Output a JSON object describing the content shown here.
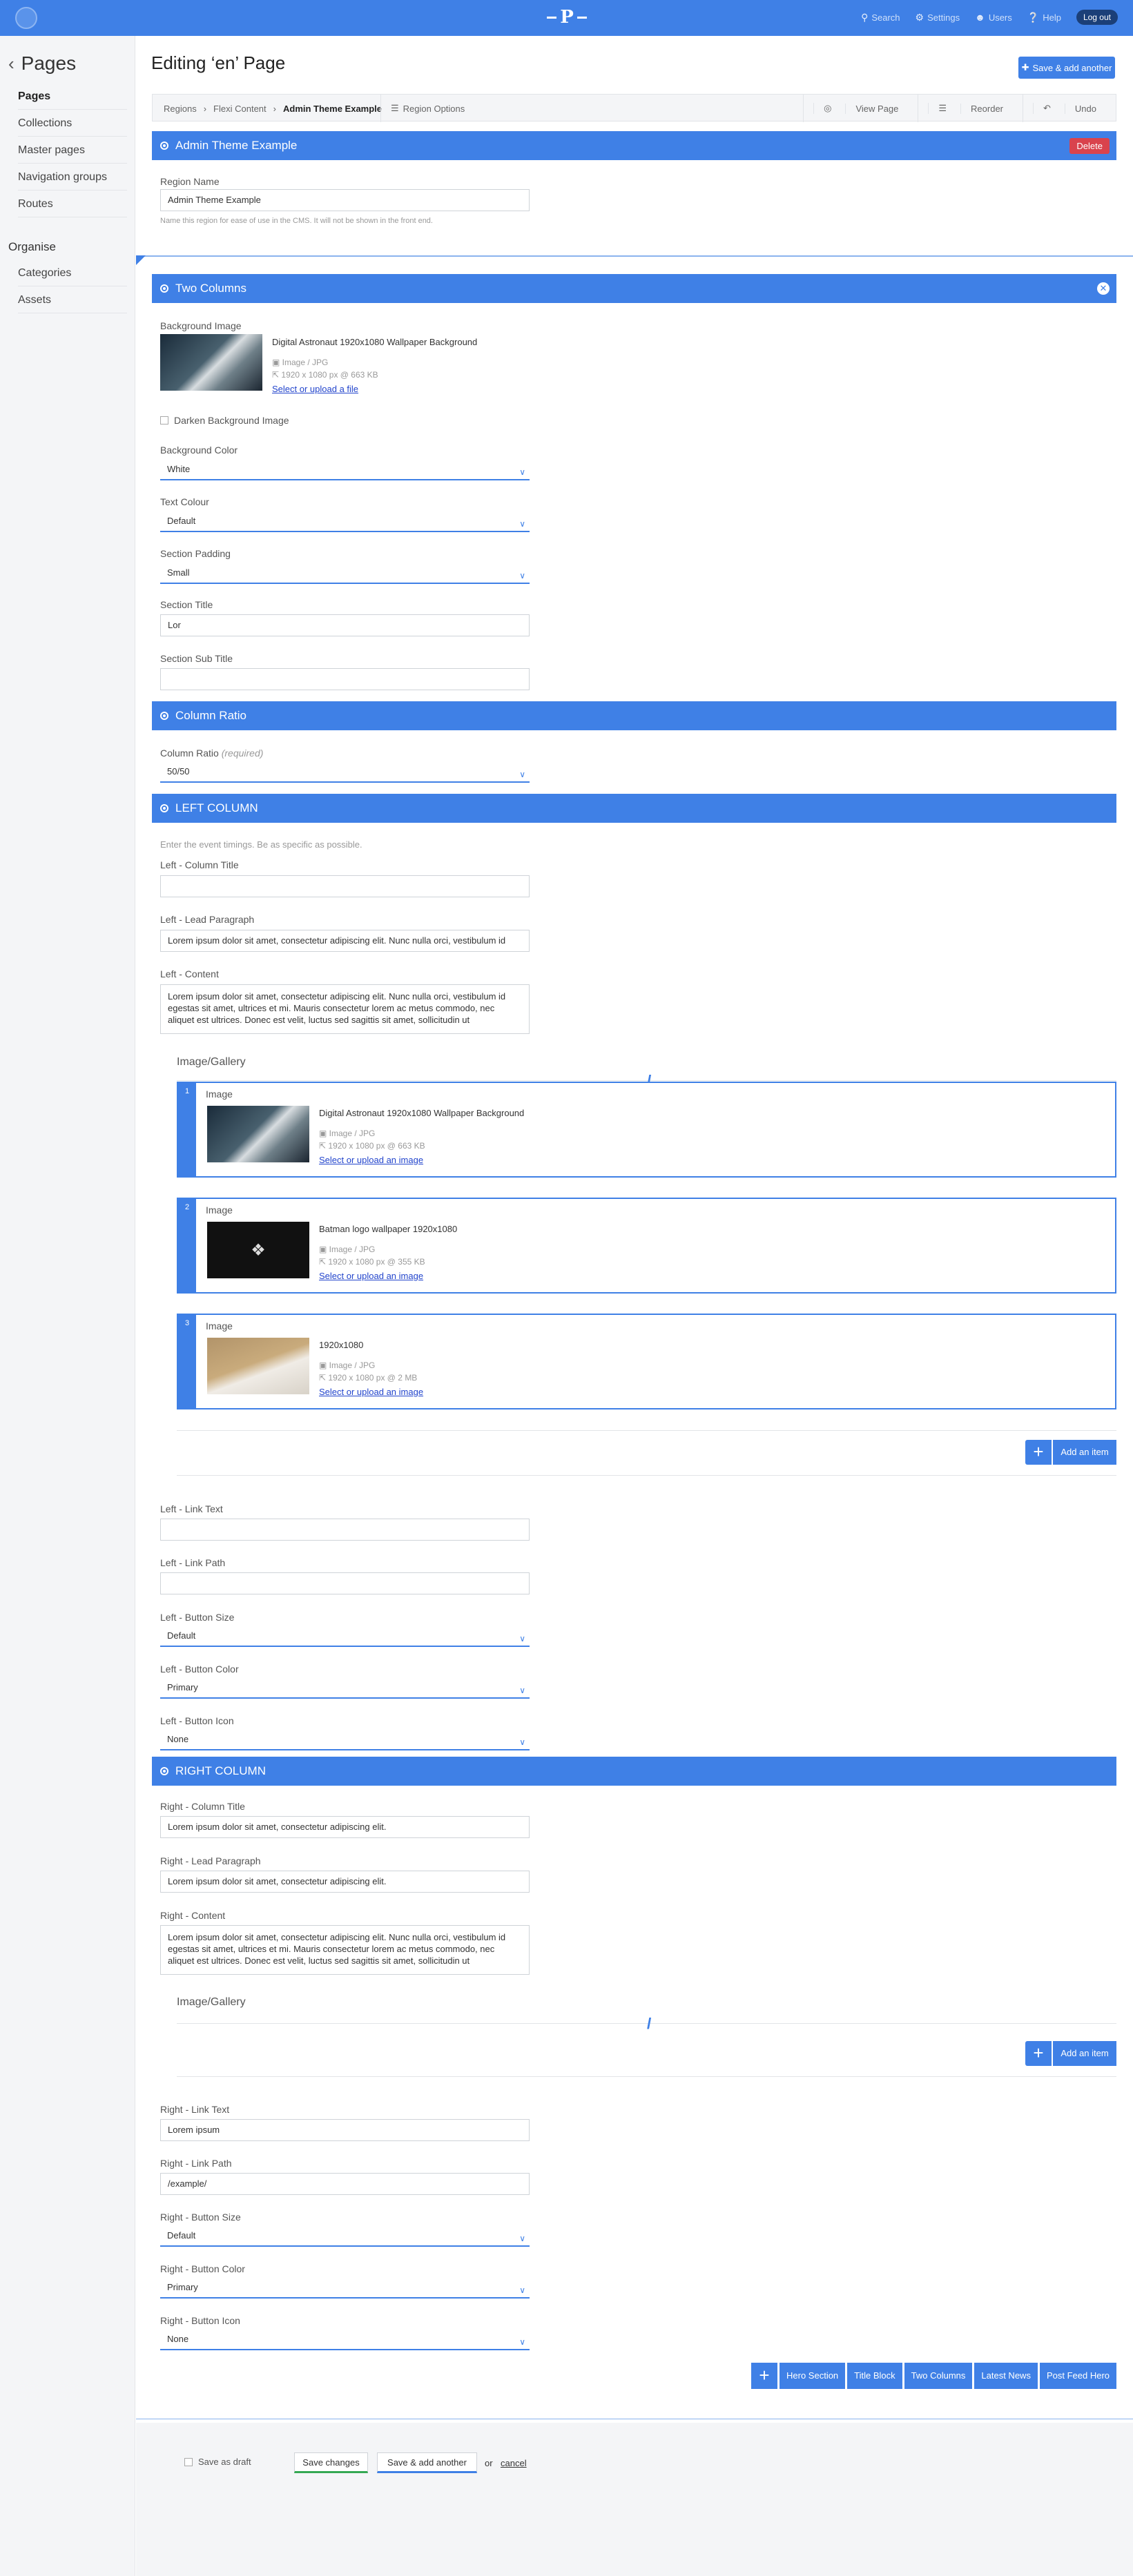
{
  "topbar": {
    "nav": [
      {
        "icon": "search-icon",
        "label": "Search"
      },
      {
        "icon": "gear-icon",
        "label": "Settings"
      },
      {
        "icon": "user-icon",
        "label": "Users"
      },
      {
        "icon": "help-icon",
        "label": "Help"
      }
    ],
    "logout": "Log out",
    "logo_letter": "P"
  },
  "sidebar": {
    "title": "Pages",
    "items": [
      "Pages",
      "Collections",
      "Master pages",
      "Navigation groups",
      "Routes"
    ],
    "organise_heading": "Organise",
    "organise_items": [
      "Categories",
      "Assets"
    ]
  },
  "page": {
    "title": "Editing ‘en’ Page",
    "save_add_another": "Save & add another"
  },
  "tabs": {
    "breadcrumb": [
      "Regions",
      "Flexi Content",
      "Admin Theme Example"
    ],
    "region_options": "Region Options",
    "view_page": "View Page",
    "reorder": "Reorder",
    "undo": "Undo"
  },
  "region": {
    "bar_title": "Admin Theme Example",
    "delete": "Delete",
    "name_label": "Region Name",
    "name_value": "Admin Theme Example",
    "name_help": "Name this region for ease of use in the CMS. It will not be shown in the front end."
  },
  "two_columns": {
    "bar_title": "Two Columns",
    "bg_label": "Background Image",
    "bg_file": {
      "name": "Digital Astronaut 1920x1080 Wallpaper Background",
      "type": "Image / JPG",
      "size": "1920 x 1080 px @ 663 KB",
      "link": "Select or upload a file"
    },
    "darken": "Darken Background Image",
    "bg_color_label": "Background Color",
    "bg_color_value": "White",
    "text_colour_label": "Text Colour",
    "text_colour_value": "Default",
    "padding_label": "Section Padding",
    "padding_value": "Small",
    "section_title_label": "Section Title",
    "section_title_value": "Lor",
    "section_sub_label": "Section Sub Title",
    "section_sub_value": ""
  },
  "column_ratio": {
    "bar_title": "Column Ratio",
    "label": "Column Ratio",
    "required": "(required)",
    "value": "50/50"
  },
  "left": {
    "bar_title": "LEFT COLUMN",
    "help": "Enter the event timings. Be as specific as possible.",
    "col_title_label": "Left - Column Title",
    "col_title_value": "",
    "lead_label": "Left - Lead Paragraph",
    "lead_value": "Lorem ipsum dolor sit amet, consectetur adipiscing elit. Nunc nulla orci, vestibulum id",
    "content_label": "Left - Content",
    "content_value": "Lorem ipsum dolor sit amet, consectetur adipiscing elit. Nunc nulla orci, vestibulum id egestas sit amet, ultrices et mi. Mauris consectetur lorem ac metus commodo, nec aliquet est ultrices. Donec est velit, luctus sed sagittis sit amet, sollicitudin ut",
    "gallery_title": "Image/Gallery",
    "gallery": [
      {
        "num": "1",
        "title": "Image",
        "name": "Digital Astronaut 1920x1080 Wallpaper Background",
        "type": "Image / JPG",
        "size": "1920 x 1080 px @ 663 KB",
        "link": "Select or upload an image"
      },
      {
        "num": "2",
        "title": "Image",
        "name": "Batman logo wallpaper 1920x1080",
        "type": "Image / JPG",
        "size": "1920 x 1080 px @ 355 KB",
        "link": "Select or upload an image"
      },
      {
        "num": "3",
        "title": "Image",
        "name": "1920x1080",
        "type": "Image / JPG",
        "size": "1920 x 1080 px @ 2 MB",
        "link": "Select or upload an image"
      }
    ],
    "add_item": "Add an item",
    "link_text_label": "Left - Link Text",
    "link_text_value": "",
    "link_path_label": "Left - Link Path",
    "link_path_value": "",
    "btn_size_label": "Left - Button Size",
    "btn_size_value": "Default",
    "btn_color_label": "Left - Button Color",
    "btn_color_value": "Primary",
    "btn_icon_label": "Left - Button Icon",
    "btn_icon_value": "None"
  },
  "right": {
    "bar_title": "RIGHT COLUMN",
    "col_title_label": "Right - Column Title",
    "col_title_value": "Lorem ipsum dolor sit amet, consectetur adipiscing elit.",
    "lead_label": "Right - Lead Paragraph",
    "lead_value": "Lorem ipsum dolor sit amet, consectetur adipiscing elit.",
    "content_label": "Right - Content",
    "content_value": "Lorem ipsum dolor sit amet, consectetur adipiscing elit. Nunc nulla orci, vestibulum id egestas sit amet, ultrices et mi. Mauris consectetur lorem ac metus commodo, nec aliquet est ultrices. Donec est velit, luctus sed sagittis sit amet, sollicitudin ut",
    "gallery_title": "Image/Gallery",
    "add_item": "Add an item",
    "link_text_label": "Right - Link Text",
    "link_text_value": "Lorem ipsum",
    "link_path_label": "Right - Link Path",
    "link_path_value": "/example/",
    "btn_size_label": "Right - Button Size",
    "btn_size_value": "Default",
    "btn_color_label": "Right - Button Color",
    "btn_color_value": "Primary",
    "btn_icon_label": "Right - Button Icon",
    "btn_icon_value": "None"
  },
  "blocks": [
    "Hero Section",
    "Title Block",
    "Two Columns",
    "Latest News",
    "Post Feed Hero"
  ],
  "footer": {
    "draft": "Save as draft",
    "save": "Save changes",
    "save_add": "Save & add another",
    "or": "or",
    "cancel": "cancel"
  },
  "colors": {
    "accent": "#3f80e6",
    "danger": "#d9434d",
    "success": "#34a853"
  }
}
